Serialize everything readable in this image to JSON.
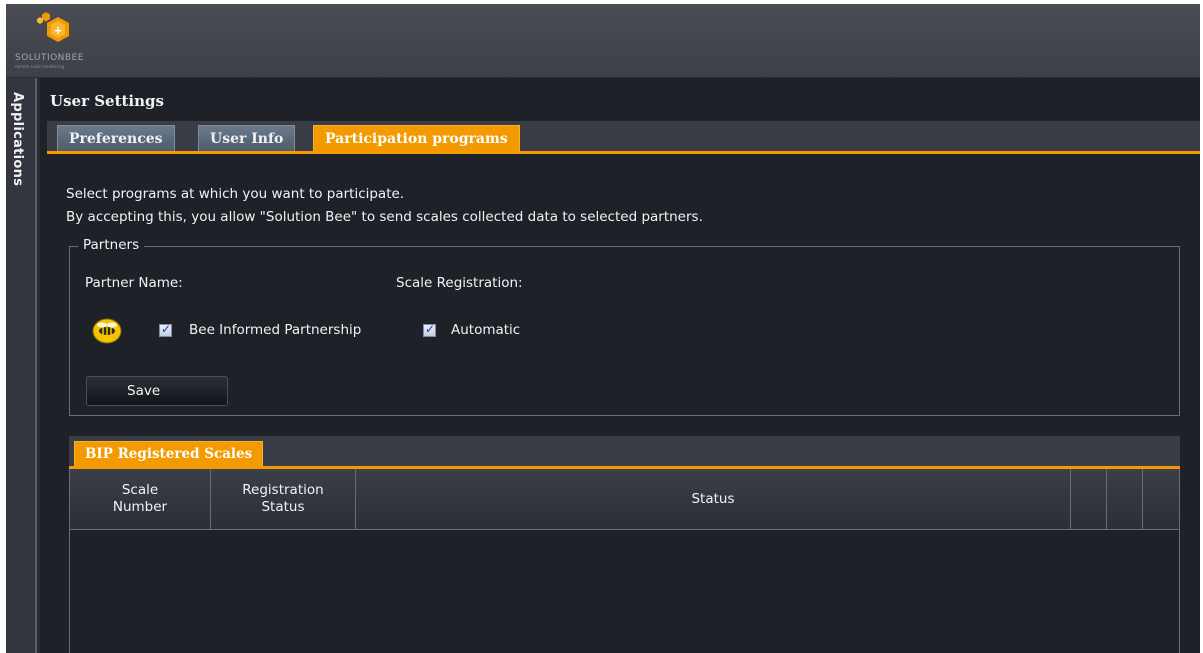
{
  "brand": {
    "name": "SOLUTIONBEE",
    "tagline": "remote scale monitoring"
  },
  "sidebar": {
    "label": "Applications"
  },
  "page": {
    "title": "User Settings"
  },
  "tabs": [
    {
      "label": "Preferences",
      "active": false
    },
    {
      "label": "User Info",
      "active": false
    },
    {
      "label": "Participation programs",
      "active": true
    }
  ],
  "participation": {
    "line1": "Select programs at which you want to participate.",
    "line2": "By accepting this, you allow \"Solution Bee\" to send scales collected data to selected partners."
  },
  "partners": {
    "legend": "Partners",
    "col_partner_name": "Partner Name:",
    "col_scale_registration": "Scale Registration:",
    "items": [
      {
        "icon": "bee-icon",
        "name": "Bee Informed Partnership",
        "selected": true,
        "registration_label": "Automatic",
        "registration_checked": true
      }
    ],
    "save_label": "Save"
  },
  "bip": {
    "tab_label": "BIP Registered Scales",
    "columns": [
      "Scale\nNumber",
      "Registration\nStatus",
      "Status",
      "",
      "",
      ""
    ],
    "rows": []
  },
  "colors": {
    "accent": "#f29a00",
    "background": "#1f2129",
    "tab_inactive": "#5c6a7a"
  }
}
